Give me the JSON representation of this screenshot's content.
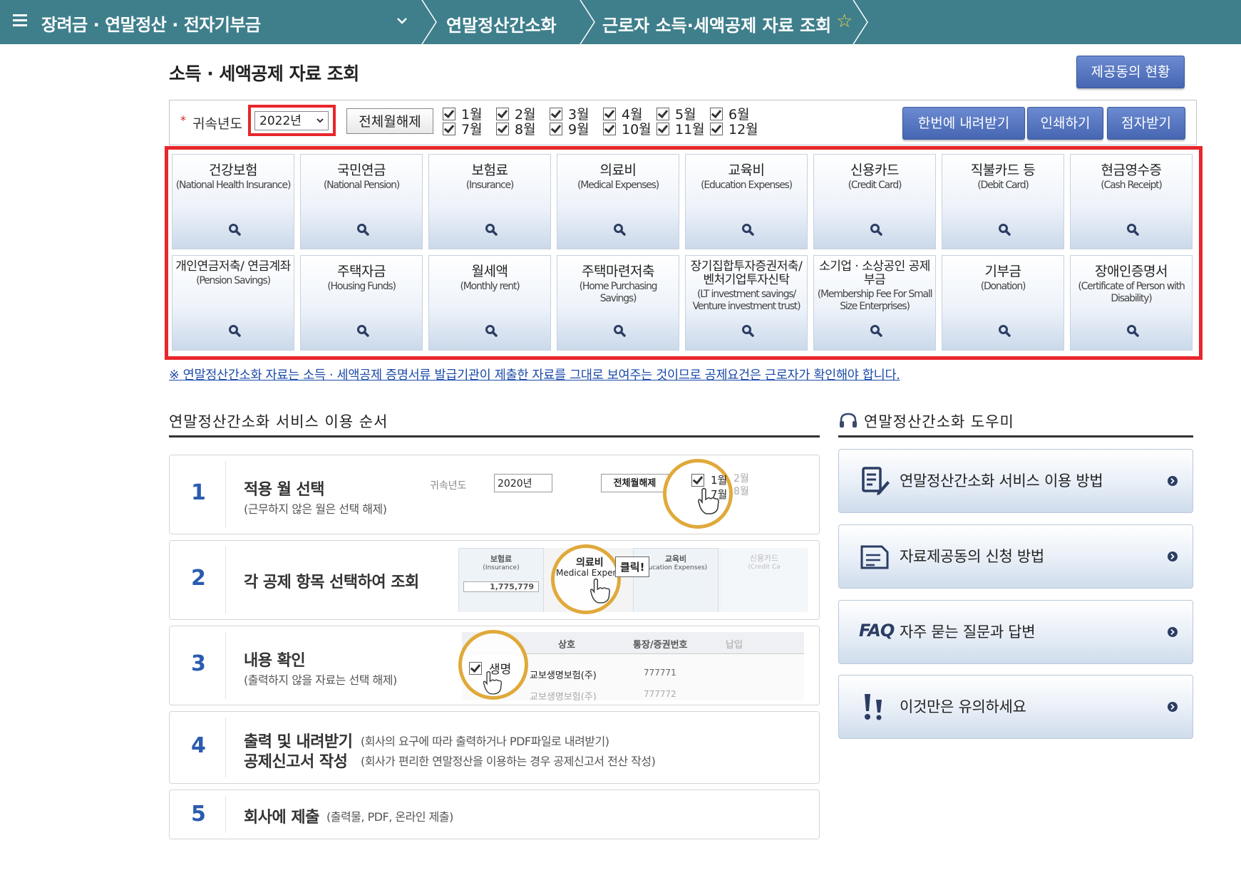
{
  "topbar": {
    "menu": "장려금 · 연말정산 · 전자기부금",
    "crumb1": "연말정산간소화",
    "crumb2": "근로자 소득·세액공제 자료 조회"
  },
  "page": {
    "title": "소득 · 세액공제 자료 조회",
    "status_button": "제공동의 현황"
  },
  "filter": {
    "required_mark": "*",
    "year_label": "귀속년도",
    "year_value": "2022년",
    "clear_all": "전체월해제",
    "months": [
      "1월",
      "2월",
      "3월",
      "4월",
      "5월",
      "6월",
      "7월",
      "8월",
      "9월",
      "10월",
      "11월",
      "12월"
    ],
    "download_all": "한번에 내려받기",
    "print": "인쇄하기",
    "braille": "점자받기"
  },
  "categories": [
    {
      "ko": "건강보험",
      "en": "(National Health Insurance)"
    },
    {
      "ko": "국민연금",
      "en": "(National Pension)"
    },
    {
      "ko": "보험료",
      "en": "(Insurance)"
    },
    {
      "ko": "의료비",
      "en": "(Medical Expenses)"
    },
    {
      "ko": "교육비",
      "en": "(Education Expenses)"
    },
    {
      "ko": "신용카드",
      "en": "(Credit Card)"
    },
    {
      "ko": "직불카드 등",
      "en": "(Debit Card)"
    },
    {
      "ko": "현금영수증",
      "en": "(Cash Receipt)"
    },
    {
      "ko": "개인연금저축/ 연금계좌",
      "en": "(Pension Savings)"
    },
    {
      "ko": "주택자금",
      "en": "(Housing Funds)"
    },
    {
      "ko": "월세액",
      "en": "(Monthly rent)"
    },
    {
      "ko": "주택마련저축",
      "en": "(Home Purchasing Savings)"
    },
    {
      "ko": "장기집합투자증권저축/ 벤처기업투자신탁",
      "en": "(LT investment savings/ Venture investment trust)"
    },
    {
      "ko": "소기업 · 소상공인 공제부금",
      "en": "(Membership Fee For Small Size Enterprises)"
    },
    {
      "ko": "기부금",
      "en": "(Donation)"
    },
    {
      "ko": "장애인증명서",
      "en": "(Certificate of Person with Disability)"
    }
  ],
  "notice": {
    "mark": "※",
    "text": "연말정산간소화 자료는 소득 · 세액공제 증명서류 발급기관이 제출한 자료를 그대로 보여주는 것이므로 공제요건은 근로자가 확인해야 합니다."
  },
  "steps_section": {
    "title": "연말정산간소화 서비스 이용 순서",
    "steps": [
      {
        "num": "1",
        "title": "적용 월 선택",
        "sub": "(근무하지 않은 월은 선택 해제)"
      },
      {
        "num": "2",
        "title": "각 공제 항목 선택하여 조회",
        "sub": ""
      },
      {
        "num": "3",
        "title": "내용 확인",
        "sub": "(출력하지 않을 자료는 선택 해제)"
      },
      {
        "num": "4",
        "title": "출력 및 내려받기",
        "title2": "공제신고서 작성",
        "note1": "(회사의 요구에 따라 출력하거나 PDF파일로 내려받기)",
        "note2": "(회사가 편리한 연말정산을 이용하는 경우 공제신고서 전산 작성)"
      },
      {
        "num": "5",
        "title": "회사에 제출",
        "note": "(출력물, PDF, 온라인 제출)"
      }
    ],
    "illus1": {
      "year_label": "귀속년도",
      "year": "2020년",
      "clear": "전체월해제",
      "m1": "1월",
      "m2": "2월",
      "m7": "7월",
      "m8": "8월"
    },
    "illus2": {
      "c1": "보험료",
      "c1en": "(Insurance)",
      "c1val": "1,775,779",
      "c2": "의료비",
      "c2en": "Medical Expenses",
      "c3": "교육비",
      "c3en": "ducation Expenses)",
      "c4": "신용카드",
      "c4en": "(Credit Ca",
      "click": "클릭!"
    },
    "illus3": {
      "h1": "상호",
      "h2": "통장/증권번호",
      "h3": "납입",
      "r1": "교보생명보험(주)",
      "r1b": "777771",
      "lens": "생명",
      "r2": "교보생명보험(주)",
      "r2b": "777772"
    }
  },
  "help": {
    "title": "연말정산간소화 도우미",
    "items": [
      {
        "label": "연말정산간소화 서비스 이용 방법",
        "icon": "document-pen-icon"
      },
      {
        "label": "자료제공동의 신청 방법",
        "icon": "document-icon"
      },
      {
        "label": "자주 묻는 질문과 답변",
        "icon": "faq-icon",
        "prefix": "FAQ"
      },
      {
        "label": "이것만은 유의하세요",
        "icon": "exclamation-icon"
      }
    ]
  },
  "colors": {
    "topbar": "#3f7f8c",
    "accent_blue": "#4666b3",
    "highlight_red": "#e8262b",
    "step_number": "#2a5bb0",
    "notice_link": "#1b4aa8"
  }
}
